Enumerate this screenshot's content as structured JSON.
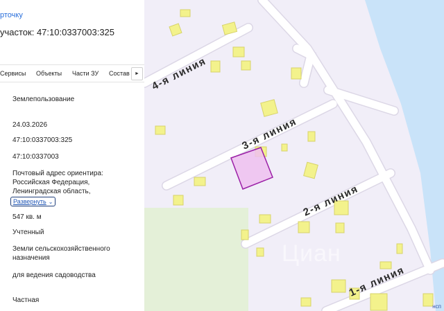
{
  "panel": {
    "back_link": "рточку",
    "title": "участок: 47:10:0337003:325",
    "tabs": [
      "Сервисы",
      "Объекты",
      "Части ЗУ",
      "Состав"
    ],
    "tabs_scroll_icon": "chevron-right-icon",
    "fields": {
      "category": "Землепользование",
      "date": "24.03.2026",
      "cadastral_number": "47:10:0337003:325",
      "quarter_number": "47:10:0337003",
      "address_line1": "Почтовый адрес ориентира:",
      "address_line2": "Российская Федерация,",
      "address_line3": "Ленинградская область,",
      "expand_label": "Развернуть",
      "area": "547 кв. м",
      "status": "Учтенный",
      "land_category_line1": "Земли сельскохозяйственного",
      "land_category_line2": "назначения",
      "permitted_use": "для ведения садоводства",
      "ownership": "Частная"
    }
  },
  "map": {
    "street_labels": [
      "4-я линия",
      "3-я линия",
      "2-я линия",
      "1-я линия"
    ],
    "watermark": "Циан",
    "attribution": "нсп",
    "colors": {
      "background": "#f1eef8",
      "road": "#ffffff",
      "road_edge": "#dcd7e6",
      "building": "#f3f28c",
      "building_edge": "#d7d36a",
      "water": "#c9e3f9",
      "green": "#e4f0d8",
      "selected_fill": "#efbff0",
      "selected_stroke": "#9b1fa6"
    }
  }
}
